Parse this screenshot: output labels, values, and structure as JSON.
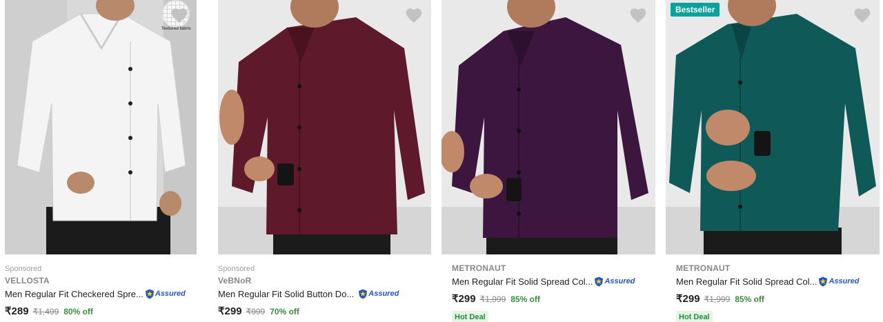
{
  "products": [
    {
      "sponsored": "Sponsored",
      "brand": "VELLOSTA",
      "title": "Men Regular Fit Checkered Spre...",
      "assured": "Assured",
      "price": "₹289",
      "mrp": "₹1,499",
      "discount": "80% off",
      "fabric_label": "Textured fabric",
      "shirt_color": "#f4f4f4"
    },
    {
      "sponsored": "Sponsored",
      "brand": "VeBNoR",
      "title": "Men Regular Fit Solid Button Do...",
      "assured": "Assured",
      "price": "₹299",
      "mrp": "₹999",
      "discount": "70% off",
      "shirt_color": "#5e1a2a"
    },
    {
      "brand": "METRONAUT",
      "title": "Men Regular Fit Solid Spread Col...",
      "assured": "Assured",
      "price": "₹299",
      "mrp": "₹1,999",
      "discount": "85% off",
      "deal": "Hot Deal",
      "shirt_color": "#3d1640"
    },
    {
      "badge": "Bestseller",
      "brand": "METRONAUT",
      "title": "Men Regular Fit Solid Spread Col...",
      "assured": "Assured",
      "price": "₹299",
      "mrp": "₹1,999",
      "discount": "85% off",
      "deal": "Hot Deal",
      "shirt_color": "#0f5a58"
    }
  ],
  "icons": {
    "wishlist": "heart-icon",
    "assured": "assured-shield-icon"
  },
  "colors": {
    "discount": "#388e3c",
    "assured": "#2455c3",
    "badge": "#0aa39b"
  }
}
